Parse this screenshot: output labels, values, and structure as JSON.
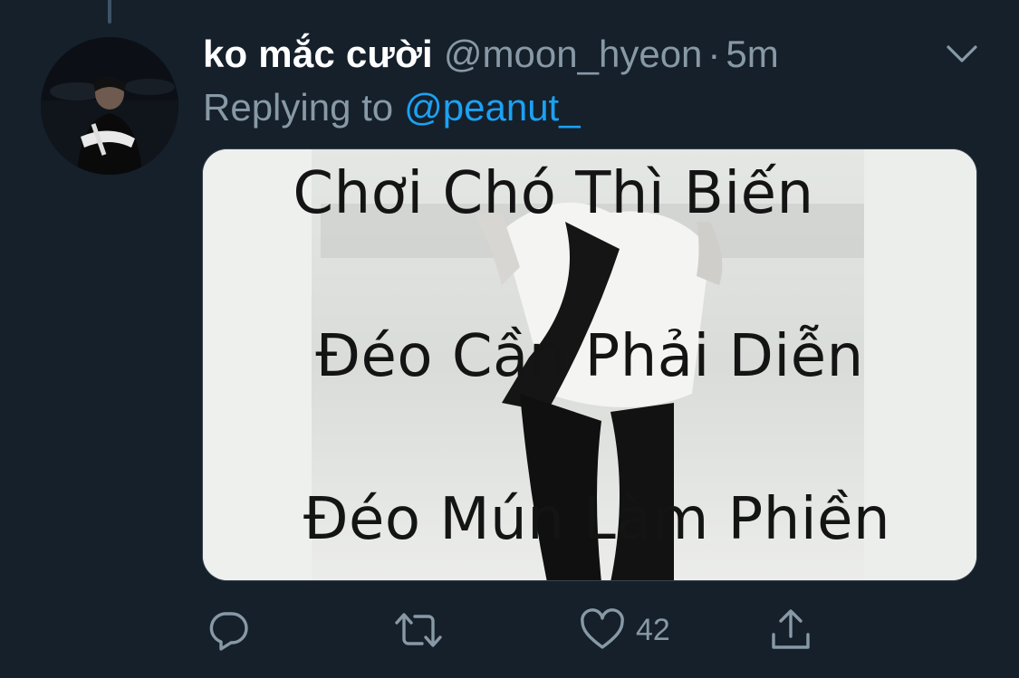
{
  "tweet": {
    "display_name": "ko mắc cười",
    "handle": "@moon_hyeon",
    "separator": "·",
    "time": "5m",
    "reply_prefix": "Replying to",
    "reply_mention": "@peanut_"
  },
  "media": {
    "lines": [
      "Chơi Chó Thì Biến",
      "Đéo Cần Phải Diễn",
      "Đéo Mún Làm Phiền"
    ]
  },
  "actions": {
    "reply_icon": "reply-icon",
    "retweet_icon": "retweet-icon",
    "like_icon": "heart-icon",
    "like_count": "42",
    "share_icon": "share-icon"
  },
  "colors": {
    "background": "#15202b",
    "secondary_text": "#8899a6",
    "link": "#1da1f2",
    "primary_text": "#ffffff"
  }
}
